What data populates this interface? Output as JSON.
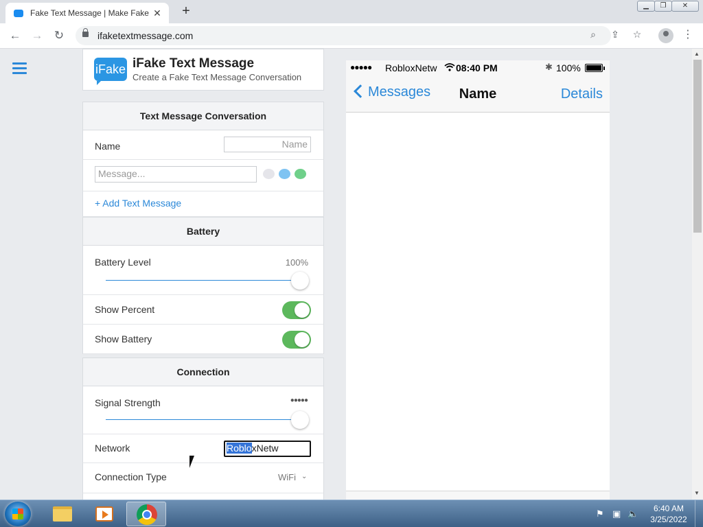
{
  "browser": {
    "tab_title": "Fake Text Message | Make Fake Text",
    "tab_close": "✕",
    "new_tab": "+",
    "url": "ifaketextmessage.com",
    "window_controls": [
      "▁",
      "❐",
      "✕"
    ]
  },
  "site": {
    "logo_text": "iFake",
    "name": "iFake Text Message",
    "tagline": "Create a Fake Text Message Conversation"
  },
  "conversation": {
    "heading": "Text Message Conversation",
    "name_label": "Name",
    "name_placeholder": "Name",
    "message_placeholder": "Message...",
    "add_link": "+ Add Text Message",
    "bubble_colors": [
      "#e5e5ea",
      "#7ec3f2",
      "#6fd08a"
    ]
  },
  "battery": {
    "heading": "Battery",
    "level_label": "Battery Level",
    "level_value": "100%",
    "level_fraction": 1.0,
    "show_percent_label": "Show Percent",
    "show_percent_on": true,
    "show_battery_label": "Show Battery",
    "show_battery_on": true
  },
  "connection": {
    "heading": "Connection",
    "signal_label": "Signal Strength",
    "signal_dots": "●●●●●",
    "signal_fraction": 1.0,
    "network_label": "Network",
    "network_selected": "Roblo",
    "network_rest": "xNetw",
    "type_label": "Connection Type",
    "type_value": "WiFi"
  },
  "phone": {
    "signal_dots": "●●●●●",
    "network": "RobloxNetw",
    "wifi_icon": "wifi-icon",
    "time": "08:40 PM",
    "bluetooth": "✱",
    "battery_pct": "100%",
    "back_label": "Messages",
    "title": "Name",
    "details": "Details"
  },
  "taskbar": {
    "clock_time": "6:40 AM",
    "clock_date": "3/25/2022"
  },
  "colors": {
    "accent": "#2b88d8",
    "toggle_on": "#5cb85c",
    "page_bg": "#e9ebee"
  }
}
